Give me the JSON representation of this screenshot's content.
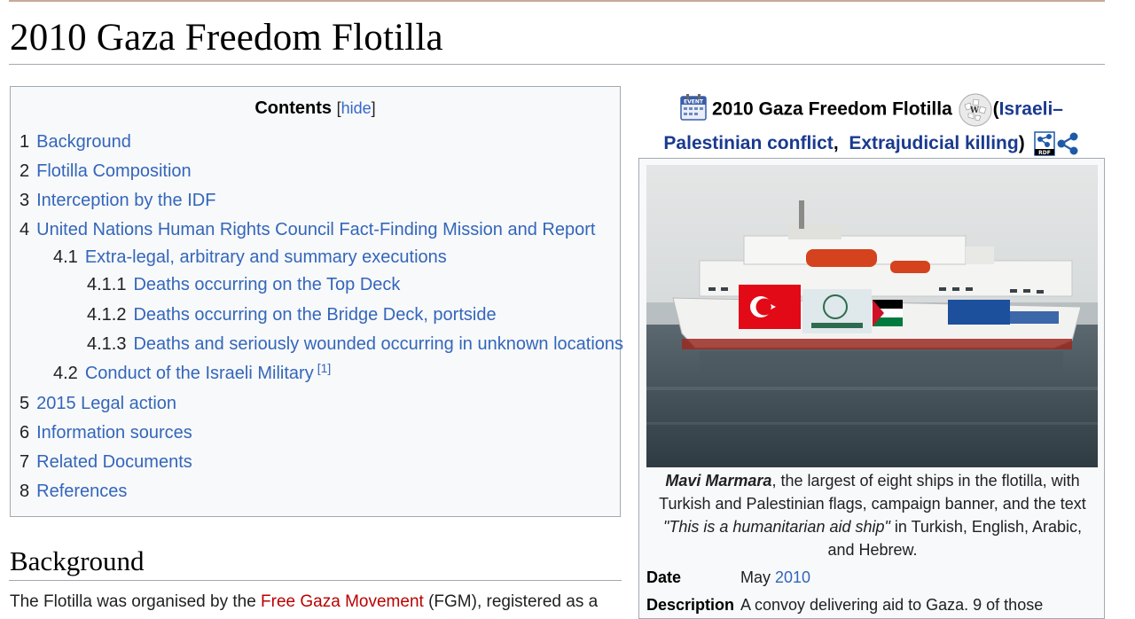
{
  "page": {
    "title": "2010 Gaza Freedom Flotilla"
  },
  "toc": {
    "heading": "Contents",
    "toggle_open": "[",
    "toggle_label": "hide",
    "toggle_close": "]",
    "items": [
      {
        "num": "1",
        "label": "Background"
      },
      {
        "num": "2",
        "label": "Flotilla Composition"
      },
      {
        "num": "3",
        "label": "Interception by the IDF"
      },
      {
        "num": "4",
        "label": "United Nations Human Rights Council Fact-Finding Mission and Report"
      },
      {
        "num": "4.1",
        "label": "Extra-legal, arbitrary and summary executions"
      },
      {
        "num": "4.1.1",
        "label": "Deaths occurring on the Top Deck"
      },
      {
        "num": "4.1.2",
        "label": "Deaths occurring on the Bridge Deck, portside"
      },
      {
        "num": "4.1.3",
        "label": "Deaths and seriously wounded occurring in unknown locations"
      },
      {
        "num": "4.2",
        "label": "Conduct of the Israeli Military",
        "sup": "[1]"
      },
      {
        "num": "5",
        "label": "2015 Legal action"
      },
      {
        "num": "6",
        "label": "Information sources"
      },
      {
        "num": "7",
        "label": "Related Documents"
      },
      {
        "num": "8",
        "label": "References"
      }
    ]
  },
  "section": {
    "heading": "Background",
    "para_start": "The Flotilla was organised by the ",
    "para_link": "Free Gaza Movement",
    "para_end": " (FGM), registered as a"
  },
  "infobox": {
    "title": "2010 Gaza Freedom Flotilla",
    "paren_open": "(",
    "link1": "Israeli–Palestinian conflict",
    "comma": ",",
    "link2": "Extrajudicial killing",
    "paren_close": ")",
    "icons": [
      "event-calendar-icon",
      "wikipedia-globe-icon",
      "rdf-icon",
      "share-graph-icon"
    ],
    "caption_bold": "Mavi Marmara",
    "caption_mid": ", the largest of eight ships in the flotilla, with Turkish and Palestinian flags, campaign banner, and the text ",
    "caption_quote": "\"This is a humanitarian aid ship\"",
    "caption_end": " in Turkish, English, Arabic, and Hebrew.",
    "date_label": "Date",
    "date_month": "May ",
    "date_year": "2010",
    "desc_label": "Description",
    "desc_value": "A convoy delivering aid to Gaza. 9 of those"
  },
  "colors": {
    "link": "#3366bb",
    "redlink": "#ba0000",
    "border": "#a2a9b1",
    "toc_bg": "#f8f9fa"
  }
}
